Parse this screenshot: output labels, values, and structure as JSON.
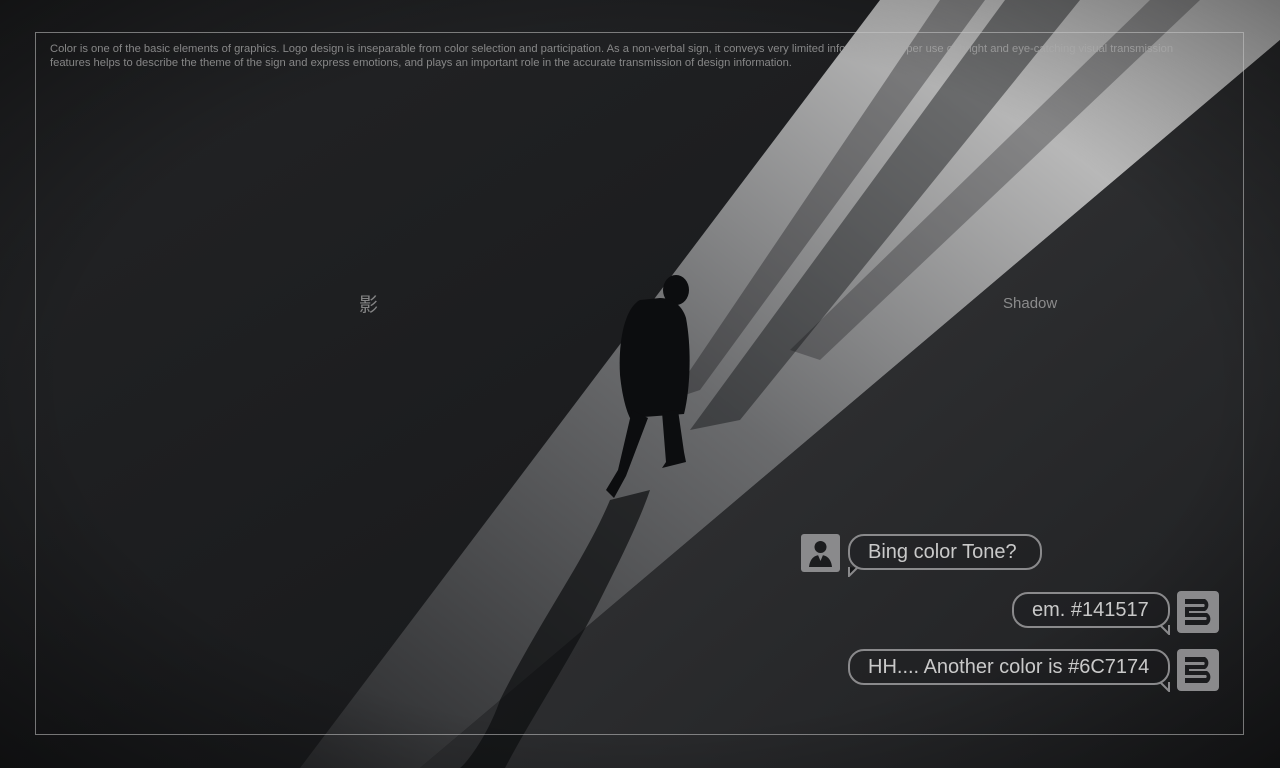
{
  "intro_text": "Color is one of the basic elements of graphics. Logo design is inseparable from color selection and participation. As a non-verbal sign, it conveys very limited information. Proper use of bright and eye-catching visual transmission features helps to describe the theme of the sign and express emotions, and plays an important role in the accurate transmission of design information.",
  "labels": {
    "chinese_char": "影",
    "english_word": "Shadow"
  },
  "chat": {
    "question": "Bing color Tone?",
    "answer_1": "em. #141517",
    "answer_2": "HH....  Another color is #6C7174"
  },
  "icons": {
    "user": "user-avatar-icon",
    "brand": "brand-logo-icon"
  },
  "colors": {
    "primary": "#141517",
    "secondary": "#6C7174",
    "bubble_border": "#8a8a8c"
  }
}
